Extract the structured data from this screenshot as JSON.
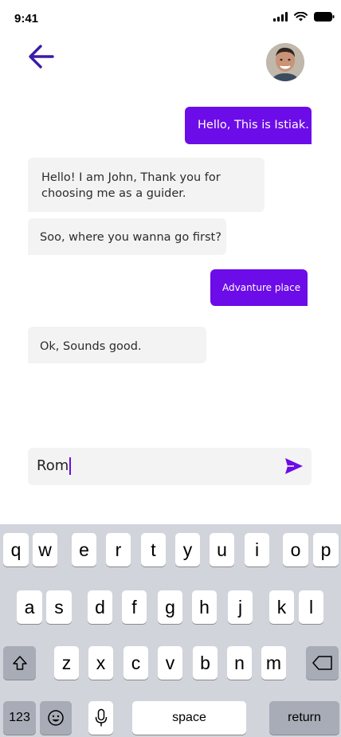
{
  "status_bar": {
    "time": "9:41"
  },
  "header": {
    "back_icon": "arrow-left-icon",
    "avatar_icon": "user-avatar"
  },
  "messages": [
    {
      "side": "out",
      "text": "Hello, This is Istiak."
    },
    {
      "side": "in",
      "lines": [
        "Hello! I am John, Thank you for",
        "choosing me as a guider."
      ]
    },
    {
      "side": "in",
      "text": "Soo, where you wanna go first?"
    },
    {
      "side": "out",
      "text": "Advanture place"
    },
    {
      "side": "in",
      "text": "Ok, Sounds good."
    }
  ],
  "composer": {
    "value": "Rom",
    "send_icon": "send-icon"
  },
  "keyboard": {
    "row1": [
      "q",
      "w",
      "e",
      "r",
      "t",
      "y",
      "u",
      "i",
      "o",
      "p"
    ],
    "row2": [
      "a",
      "s",
      "d",
      "f",
      "g",
      "h",
      "j",
      "k",
      "l"
    ],
    "row3": [
      "z",
      "x",
      "c",
      "v",
      "b",
      "n",
      "m"
    ],
    "numbers_label": "123",
    "space_label": "space",
    "return_label": "return"
  },
  "colors": {
    "accent": "#6c0ce8",
    "incoming_bubble": "#f3f3f3",
    "keyboard_bg": "#d1d4da"
  }
}
